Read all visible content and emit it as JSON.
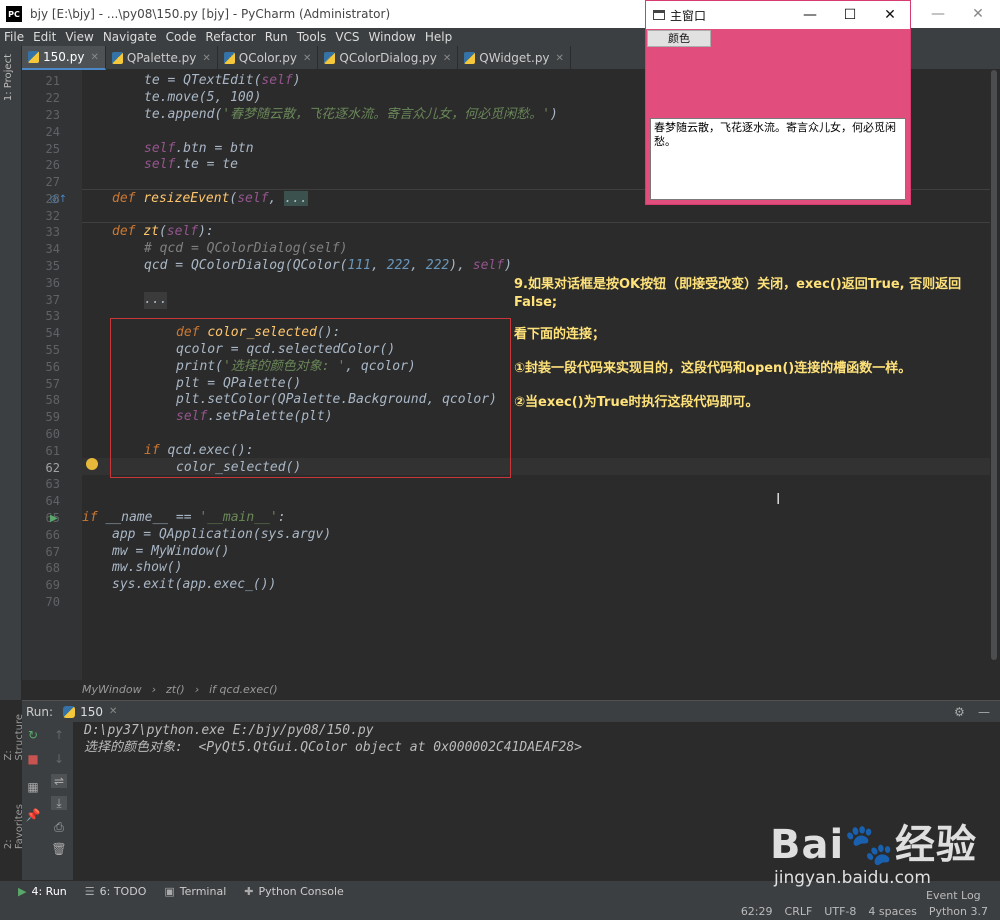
{
  "titlebar": {
    "title": "bjy [E:\\bjy] - ...\\py08\\150.py [bjy] - PyCharm (Administrator)",
    "logo": "PC"
  },
  "menu": [
    "File",
    "Edit",
    "View",
    "Navigate",
    "Code",
    "Refactor",
    "Run",
    "Tools",
    "VCS",
    "Window",
    "Help"
  ],
  "tabs": [
    "150.py",
    "QPalette.py",
    "QColor.py",
    "QColorDialog.py",
    "QWidget.py"
  ],
  "sidebar": {
    "project": "1: Project",
    "structure": "Z: Structure",
    "favorites": "2: Favorites"
  },
  "line_numbers": [
    "21",
    "22",
    "23",
    "24",
    "25",
    "26",
    "27",
    "28",
    "32",
    "33",
    "34",
    "35",
    "36",
    "37",
    "53",
    "54",
    "55",
    "56",
    "57",
    "58",
    "59",
    "60",
    "61",
    "62",
    "63",
    "64",
    "65",
    "66",
    "67",
    "68",
    "69",
    "70"
  ],
  "code": {
    "l21_a": "te = ",
    "l21_b": "QTextEdit(",
    "l21_c": "self",
    ")": ")",
    "l22": "te.move(5, 100)",
    "l23_a": "te.append(",
    "l23_b": "'春梦随云散，飞花逐水流。寄言众儿女，何必觅闲愁。'",
    "l23_c": ")",
    "l25_a": "self",
    ".btn": ".btn = btn",
    "l26_a": "self",
    ".te": ".te = te",
    "l28_a": "def ",
    "l28_b": "resizeEvent",
    "l28_c": "(",
    "l28_d": "self",
    ", ": ", ",
    "l28_e": "...",
    "l33_a": "def ",
    "l33_b": "zt",
    "l33_c": "(",
    "l33_d": "self",
    "l33_e": "):",
    "l34": "# qcd = QColorDialog(self)",
    "l35_a": "qcd = QColorDialog(QColor(",
    "l35_b": "111",
    "l35_c": "222",
    "l35_d": "222",
    "l35_e": "), ",
    "l35_f": "self",
    "l35_g": ")",
    "l37": "...",
    "l54_a": "def ",
    "l54_b": "color_selected",
    "l54_c": "():",
    "l55": "qcolor = qcd.selectedColor()",
    "l56_a": "print(",
    "l56_b": "'选择的颜色对象: '",
    ", qcolor)": ", qcolor)",
    "l57": "plt = QPalette()",
    "l58": "plt.setColor(QPalette.Background, qcolor)",
    "l59_a": "self",
    "l59_b": ".setPalette(plt)",
    "l61_a": "if ",
    "l61_b": "qcd.exec():",
    "l62": "color_selected()",
    "l65_a": "if ",
    "l65_b": "__name__ == ",
    "l65_c": "'__main__'",
    "l65_d": ":",
    "l66": "app = QApplication(sys.argv)",
    "l67": "mw = MyWindow()",
    "l68": "mw.show()",
    "l69": "sys.exit(app.exec_())"
  },
  "annotations": {
    "a1": "9.如果对话框是按OK按钮（即接受改变）关闭，exec()返回True, 否则返回False;",
    "a2": "看下面的连接；",
    "a3": "①封装一段代码来实现目的，这段代码和open()连接的槽函数一样。",
    "a4": "②当exec()为True时执行这段代码即可。"
  },
  "breadcrumb": [
    "MyWindow",
    "zt()",
    "if qcd.exec()"
  ],
  "run": {
    "label": "Run:",
    "tab": "150",
    "line1": "D:\\py37\\python.exe E:/bjy/py08/150.py",
    "line2": "选择的颜色对象:  <PyQt5.QtGui.QColor object at 0x000002C41DAEAF28>"
  },
  "bottom_tabs": [
    "4: Run",
    "6: TODO",
    "Terminal",
    "Python Console"
  ],
  "status": {
    "pos": "62:29",
    "eol": "CRLF",
    "enc": "UTF-8",
    "indent": "4 spaces",
    "interp": "Python 3.7",
    "eventlog": "Event Log"
  },
  "qt_window": {
    "title": "主窗口",
    "button": "颜色",
    "text": "春梦随云散，飞花逐水流。寄言众儿女，何必觅闲愁。",
    "bg": "#e14d7c"
  },
  "watermark": {
    "big": "Bai🐾经验",
    "small": "jingyan.baidu.com"
  }
}
